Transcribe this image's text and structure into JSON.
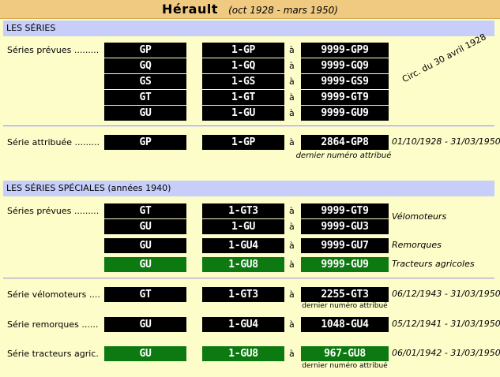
{
  "title": {
    "main": "Hérault",
    "sub": "(oct 1928 - mars 1950)"
  },
  "sections": {
    "series": "LES SÉRIES",
    "special": "LES SÉRIES SPÉCIALES (années 1940)"
  },
  "connector": "à",
  "series": {
    "label": "Séries prévues .........",
    "rows": [
      {
        "code": "GP",
        "from": "1-GP",
        "to": "9999-GP9"
      },
      {
        "code": "GQ",
        "from": "1-GQ",
        "to": "9999-GQ9"
      },
      {
        "code": "GS",
        "from": "1-GS",
        "to": "9999-GS9"
      },
      {
        "code": "GT",
        "from": "1-GT",
        "to": "9999-GT9"
      },
      {
        "code": "GU",
        "from": "1-GU",
        "to": "9999-GU9"
      }
    ],
    "circ_note": "Circ. du 30 avril 1928"
  },
  "attributed": {
    "label": "Série attribuée .........",
    "code": "GP",
    "from": "1-GP",
    "to": "2864-GP8",
    "dates": "01/10/1928 - 31/03/1950",
    "last_note": "dernier numéro attribué"
  },
  "special_planned": {
    "label": "Séries prévues .........",
    "rows": [
      {
        "code": "GT",
        "from": "1-GT3",
        "to": "9999-GT9",
        "note": "Vélomoteurs",
        "green": false
      },
      {
        "code": "GU",
        "from": "1-GU",
        "to": "9999-GU3",
        "note": "",
        "green": false
      },
      {
        "code": "GU",
        "from": "1-GU4",
        "to": "9999-GU7",
        "note": "Remorques",
        "green": false
      },
      {
        "code": "GU",
        "from": "1-GU8",
        "to": "9999-GU9",
        "note": "Tracteurs agricoles",
        "green": true
      }
    ]
  },
  "special_attributed": [
    {
      "label": "Série vélomoteurs ....",
      "code": "GT",
      "from": "1-GT3",
      "to": "2255-GT3",
      "dates": "06/12/1943 - 31/03/1950",
      "last_note": "dernier numéro attribué",
      "green": false
    },
    {
      "label": "Série remorques ......",
      "code": "GU",
      "from": "1-GU4",
      "to": "1048-GU4",
      "dates": "05/12/1941 - 31/03/1950",
      "last_note": "",
      "green": false
    },
    {
      "label": "Série tracteurs agric.",
      "code": "GU",
      "from": "1-GU8",
      "to": "967-GU8",
      "dates": "06/01/1942 - 31/03/1950",
      "last_note": "dernier numéro attribué",
      "green": true
    }
  ],
  "colors": {
    "plate_black": "#000000",
    "plate_green": "#0c7a11",
    "section_bar": "#c6cef9",
    "title_bar": "#f0ca80"
  }
}
